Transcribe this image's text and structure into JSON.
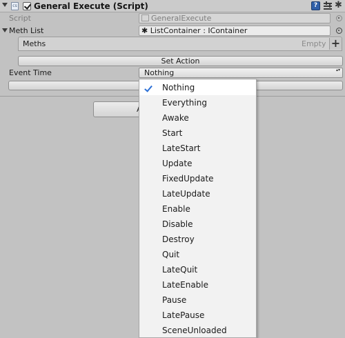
{
  "component": {
    "title": "General Execute (Script)",
    "enabled": true,
    "script_icon_text": "cs",
    "help_icon_text": "?",
    "gear_glyph": "✱"
  },
  "fields": {
    "script_label": "Script",
    "script_value": "GeneralExecute",
    "meth_list_label": "Meth List",
    "meth_list_value": "ListContainer : IContainer",
    "meth_list_prefix": "✱"
  },
  "meths": {
    "label": "Meths",
    "empty_label": "Empty",
    "add_glyph": "+"
  },
  "set_action_button": "Set Action",
  "event_time": {
    "label": "Event Time",
    "value": "Nothing",
    "updown_glyph": "▴▾"
  },
  "partial_button_visible_text": "A",
  "dropdown": {
    "selected": "Nothing",
    "check_color": "#2b6fd6",
    "options": [
      "Nothing",
      "Everything",
      "Awake",
      "Start",
      "LateStart",
      "Update",
      "FixedUpdate",
      "LateUpdate",
      "Enable",
      "Disable",
      "Destroy",
      "Quit",
      "LateQuit",
      "LateEnable",
      "Pause",
      "LatePause",
      "SceneUnloaded"
    ]
  }
}
